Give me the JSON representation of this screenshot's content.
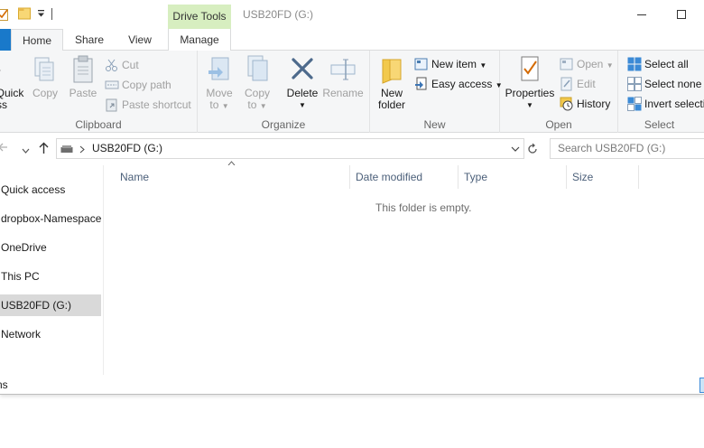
{
  "window": {
    "title": "USB20FD (G:)"
  },
  "context_tab": "Drive Tools",
  "tabs": {
    "home": "Home",
    "share": "Share",
    "view": "View",
    "manage": "Manage"
  },
  "ribbon": {
    "clipboard": {
      "label": "Clipboard",
      "quick_access_line1": "Quick",
      "quick_access_line2": "ss",
      "copy": "Copy",
      "paste": "Paste",
      "cut": "Cut",
      "copy_path": "Copy path",
      "paste_shortcut": "Paste shortcut"
    },
    "organize": {
      "label": "Organize",
      "move_to_line1": "Move",
      "move_to_line2": "to",
      "copy_to_line1": "Copy",
      "copy_to_line2": "to",
      "delete": "Delete",
      "rename": "Rename"
    },
    "new": {
      "label": "New",
      "new_folder_line1": "New",
      "new_folder_line2": "folder",
      "new_item": "New item",
      "easy_access": "Easy access"
    },
    "open": {
      "label": "Open",
      "properties": "Properties",
      "open": "Open",
      "edit": "Edit",
      "history": "History"
    },
    "select": {
      "label": "Select",
      "select_all": "Select all",
      "select_none": "Select none",
      "invert_selection": "Invert selection"
    }
  },
  "address": {
    "path": "USB20FD (G:)",
    "search_placeholder": "Search USB20FD (G:)"
  },
  "nav_pane": {
    "items": [
      {
        "label": "Quick access"
      },
      {
        "label": "dropbox-Namespace"
      },
      {
        "label": "OneDrive"
      },
      {
        "label": "This PC"
      },
      {
        "label": "USB20FD (G:)"
      },
      {
        "label": "Network"
      }
    ]
  },
  "columns": {
    "name": "Name",
    "date_modified": "Date modified",
    "type": "Type",
    "size": "Size"
  },
  "content": {
    "empty_message": "This folder is empty."
  },
  "status": {
    "text": "ns"
  },
  "colors": {
    "accent": "#1979ca",
    "context_tab": "#d7eec0",
    "selected_nav": "#d9d9d9"
  }
}
